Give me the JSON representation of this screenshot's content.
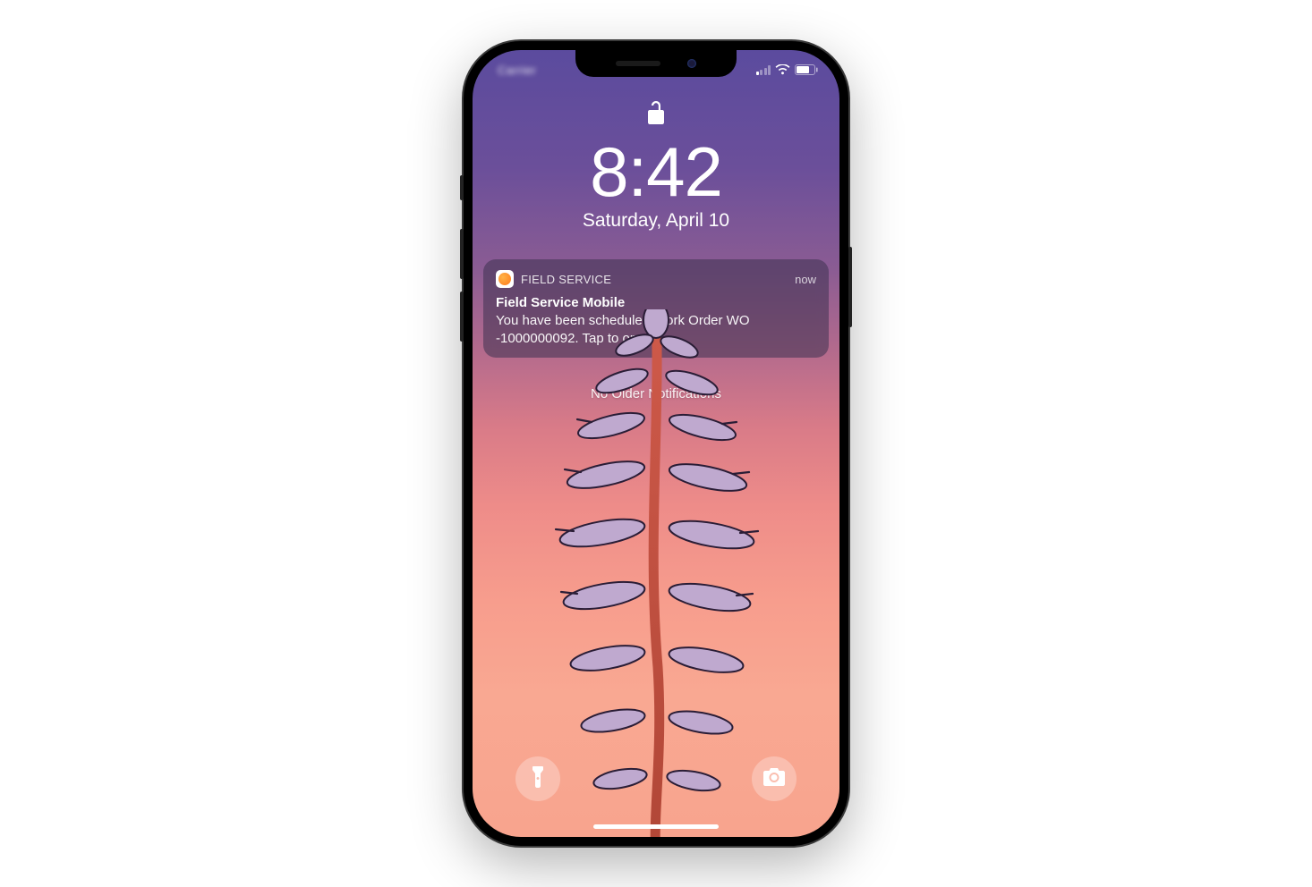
{
  "status_bar": {
    "carrier_blurred": "Carrier"
  },
  "lock_screen": {
    "time": "8:42",
    "date": "Saturday, April 10",
    "no_older_text": "No Older Notifications"
  },
  "notification": {
    "app_name": "FIELD SERVICE",
    "timestamp": "now",
    "title": "Field Service Mobile",
    "body": "You have been scheduled Work Order WO -1000000092. Tap to open."
  }
}
